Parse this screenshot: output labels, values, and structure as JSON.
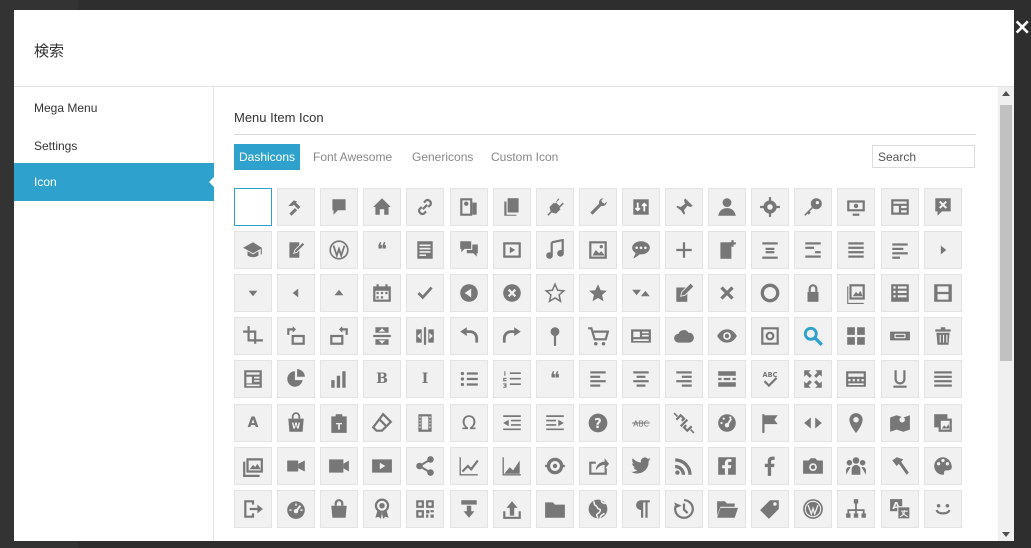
{
  "modal": {
    "title": "検索",
    "close_glyph": "×"
  },
  "sidebar": {
    "items": [
      {
        "label": "Mega Menu",
        "active": false
      },
      {
        "label": "Settings",
        "active": false
      },
      {
        "label": "Icon",
        "active": true
      }
    ]
  },
  "content": {
    "section_title": "Menu Item Icon",
    "tabs": [
      {
        "label": "Dashicons",
        "active": true
      },
      {
        "label": "Font Awesome",
        "active": false
      },
      {
        "label": "Genericons",
        "active": false
      },
      {
        "label": "Custom Icon",
        "active": false
      }
    ],
    "search": {
      "placeholder": "Search",
      "value": ""
    }
  },
  "colors": {
    "accent": "#2ea2cc",
    "icon": "#777777",
    "search_icon": "#2ea2cc",
    "cell_bg": "#f1f1f1"
  },
  "icons": [
    "blank",
    "hammer-icon",
    "comment-icon",
    "home-icon",
    "link-icon",
    "media-audio-icon",
    "copy-icon",
    "plugin-icon",
    "wrench-icon",
    "sort-icon",
    "pin-icon",
    "user-icon",
    "gear-icon",
    "key-icon",
    "monitor-icon",
    "layout-icon",
    "dismiss-comment-icon",
    "graduation-cap-icon",
    "edit-page-icon",
    "wordpress-icon",
    "quote-icon",
    "text-page-icon",
    "comments-icon",
    "video-icon",
    "music-icon",
    "image-icon",
    "speech-bubble-icon",
    "plus-icon",
    "new-page-icon",
    "align-center-icon",
    "align-right-icon",
    "align-left-block-icon",
    "align-left-icon",
    "arrow-right-icon",
    "arrow-down-icon",
    "arrow-left-icon",
    "arrow-up-icon",
    "calendar-icon",
    "check-icon",
    "back-circle-icon",
    "close-circle-icon",
    "star-empty-icon",
    "star-filled-icon",
    "sort-arrows-icon",
    "edit-doc-icon",
    "close-icon",
    "circle-icon",
    "lock-icon",
    "gallery-icon",
    "list-view-icon",
    "film-strip-icon",
    "crop-icon",
    "rotate-left-icon",
    "rotate-right-icon",
    "flip-vertical-icon",
    "flip-horizontal-icon",
    "undo-icon",
    "redo-icon",
    "location-pin-icon",
    "cart-icon",
    "id-card-icon",
    "cloud-icon",
    "eye-icon",
    "camera-box-icon",
    "search-icon",
    "grid-icon",
    "keyboard-icon",
    "trash-icon",
    "news-icon",
    "pie-chart-icon",
    "bar-chart-icon",
    "bold-icon",
    "italic-icon",
    "bullet-list-icon",
    "numbered-list-icon",
    "blockquote-icon",
    "text-left-icon",
    "text-center-icon",
    "text-right-icon",
    "insert-more-icon",
    "spellcheck-icon",
    "fullscreen-icon",
    "kitchen-sink-icon",
    "underline-icon",
    "justify-icon",
    "text-color-icon",
    "woo-bag-icon",
    "paste-text-icon",
    "eraser-icon",
    "film-icon",
    "omega-icon",
    "outdent-icon",
    "indent-icon",
    "help-icon",
    "strikethrough-icon",
    "unlink-icon",
    "dashboard-icon",
    "flag-icon",
    "code-arrows-icon",
    "location-icon",
    "map-book-icon",
    "images-icon",
    "photos-icon",
    "video-camera-icon",
    "video-alt-icon",
    "youtube-icon",
    "share-icon",
    "line-chart-icon",
    "area-chart-icon",
    "ring-icon",
    "share-arrow-icon",
    "twitter-icon",
    "rss-icon",
    "facebook-icon",
    "facebook-f-icon",
    "camera-icon",
    "groups-icon",
    "hammer-alt-icon",
    "art-icon",
    "migrate-icon",
    "performance-icon",
    "cart-bag-icon",
    "award-icon",
    "qr-grid-icon",
    "download-icon",
    "upload-icon",
    "folder-icon",
    "globe-icon",
    "paragraph-icon",
    "backup-icon",
    "folder-open-icon",
    "tag-icon",
    "wordpress-alt-icon",
    "networking-icon",
    "translation-icon",
    "smiley-icon"
  ]
}
